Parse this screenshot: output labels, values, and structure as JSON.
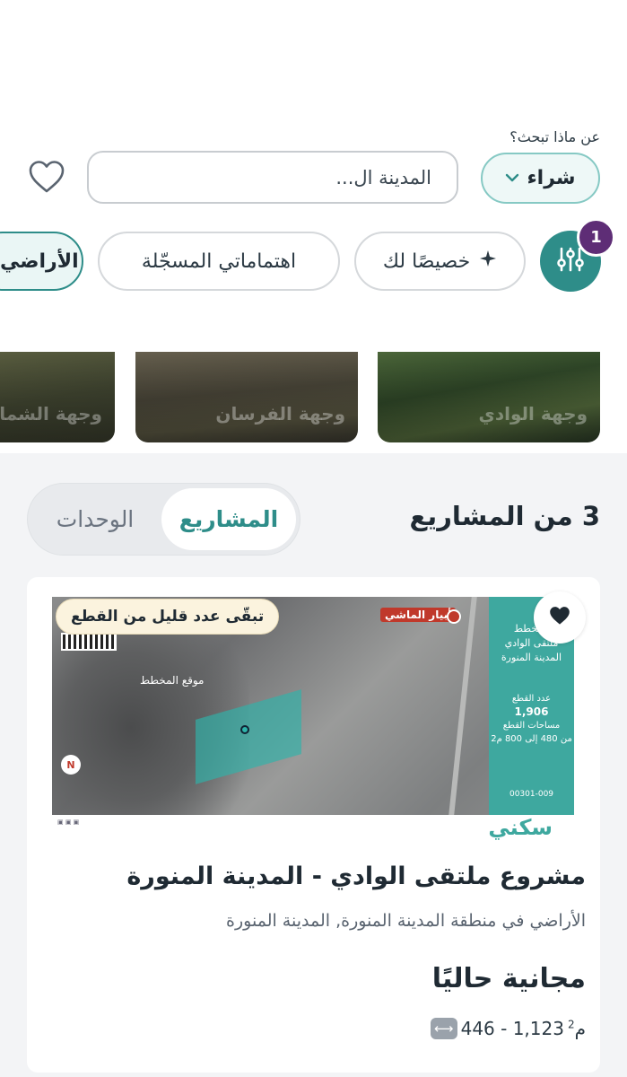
{
  "search": {
    "label": "عن ماذا تبحث؟",
    "type_value": "شراء",
    "city_placeholder": "المدينة ال..."
  },
  "filters": {
    "badge_count": "1",
    "chips": [
      {
        "label": "خصيصًا لك",
        "icon": "sparkle-icon"
      },
      {
        "label": "اهتماماتي المسجّلة"
      },
      {
        "label": "الأراضي"
      }
    ]
  },
  "destinations": [
    {
      "label": "وجهة الوادي"
    },
    {
      "label": "وجهة الفرسان"
    },
    {
      "label": "وجهة الشمال"
    }
  ],
  "results": {
    "title": "3 من المشاريع",
    "tabs": [
      {
        "label": "المشاريع",
        "active": true
      },
      {
        "label": "الوحدات",
        "active": false
      }
    ]
  },
  "listing": {
    "badge": "تبقّى عدد قليل من القطع",
    "title": "مشروع ملتقى الوادي - المدينة المنورة",
    "subtitle": "الأراضي في منطقة المدينة المنورة, المدينة المنورة",
    "price": "مجانية حاليًا",
    "area": "446 - 1,123",
    "area_unit": "م",
    "area_unit_sup": "2",
    "favorited": true,
    "map": {
      "plot_label": "موقع المخطط",
      "pin_label": "أبيار الماشي",
      "north": "N",
      "strip_title_1": "المخطط",
      "strip_title_2": "ملتقى الوادي",
      "strip_title_3": "المدينة المنورة",
      "plots_count_label": "عدد القطع",
      "plots_count": "1,906",
      "plots_area_label": "مساحات القطع",
      "plots_area": "من 480 إلى 800 م2",
      "plan_code": "00301-009",
      "brand": "سكني"
    }
  },
  "colors": {
    "accent": "#2e8d89",
    "badge_purple": "#5e2d76",
    "brand_teal": "#3ea89f"
  }
}
